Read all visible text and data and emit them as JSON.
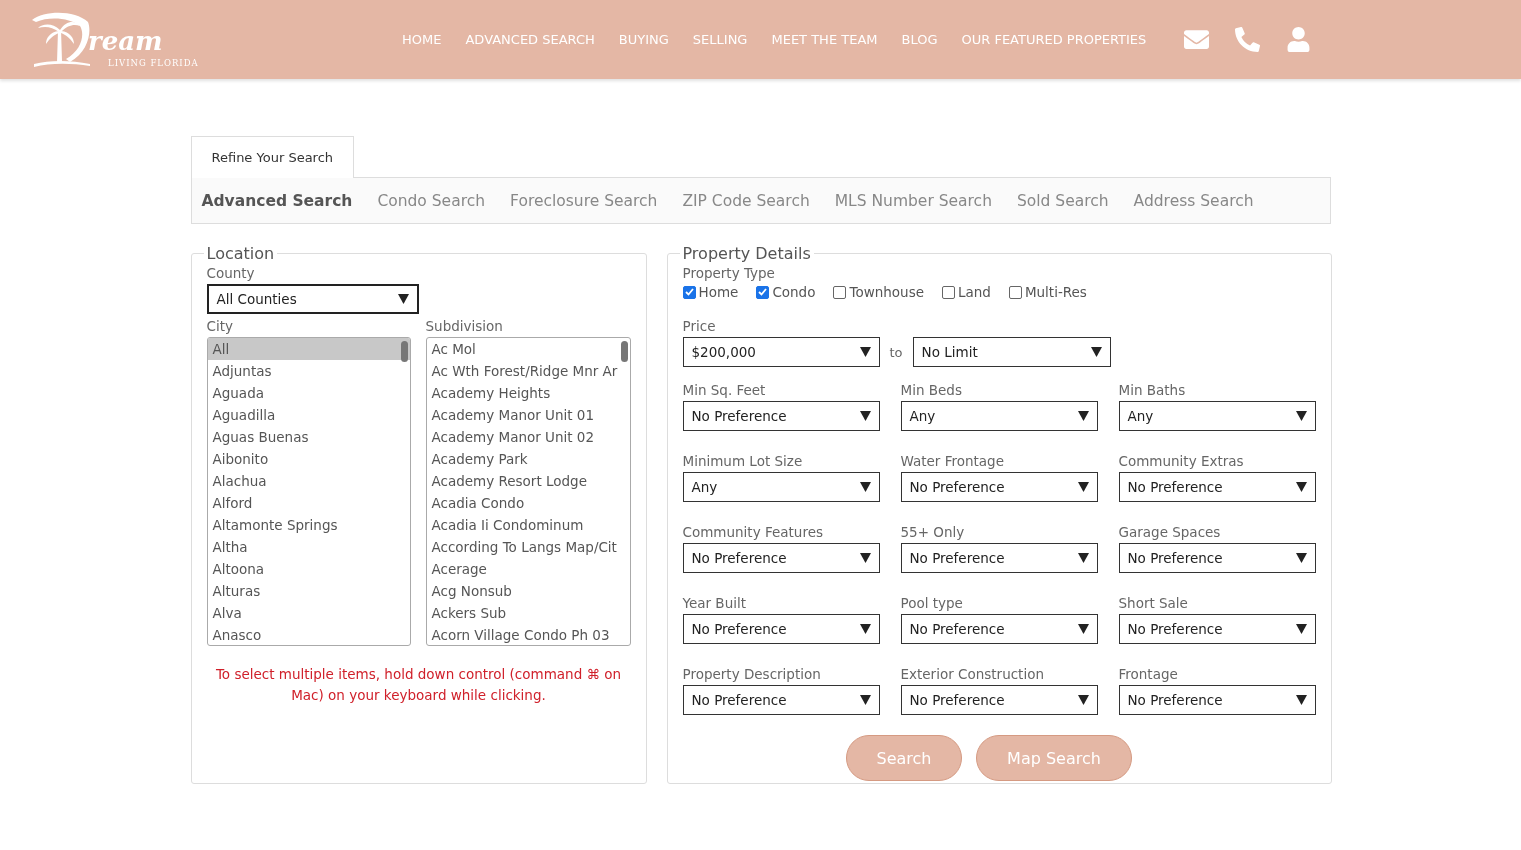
{
  "header": {
    "logo": {
      "title": "ream",
      "tagline": "LIVING FLORIDA"
    },
    "nav": [
      "HOME",
      "ADVANCED SEARCH",
      "BUYING",
      "SELLING",
      "MEET THE TEAM",
      "BLOG",
      "OUR FEATURED PROPERTIES"
    ]
  },
  "refine_tab": {
    "label": "Refine Your Search",
    "selected": true
  },
  "search_tabs": [
    {
      "label": "Advanced Search",
      "selected": true
    },
    {
      "label": "Condo Search",
      "selected": false
    },
    {
      "label": "Foreclosure Search",
      "selected": false
    },
    {
      "label": "ZIP Code Search",
      "selected": false
    },
    {
      "label": "MLS Number Search",
      "selected": false
    },
    {
      "label": "Sold Search",
      "selected": false
    },
    {
      "label": "Address Search",
      "selected": false
    }
  ],
  "location": {
    "legend": "Location",
    "county": {
      "label": "County",
      "value": "All Counties"
    },
    "city": {
      "label": "City",
      "items": [
        {
          "label": "All",
          "selected": true
        },
        {
          "label": "Adjuntas",
          "selected": false
        },
        {
          "label": "Aguada",
          "selected": false
        },
        {
          "label": "Aguadilla",
          "selected": false
        },
        {
          "label": "Aguas Buenas",
          "selected": false
        },
        {
          "label": "Aibonito",
          "selected": false
        },
        {
          "label": "Alachua",
          "selected": false
        },
        {
          "label": "Alford",
          "selected": false
        },
        {
          "label": "Altamonte Springs",
          "selected": false
        },
        {
          "label": "Altha",
          "selected": false
        },
        {
          "label": "Altoona",
          "selected": false
        },
        {
          "label": "Alturas",
          "selected": false
        },
        {
          "label": "Alva",
          "selected": false
        },
        {
          "label": "Anasco",
          "selected": false
        }
      ]
    },
    "subdivision": {
      "label": "Subdivision",
      "items": [
        {
          "label": "Ac Mol",
          "selected": false
        },
        {
          "label": "Ac Wth Forest/Ridge Mnr Ar",
          "selected": false
        },
        {
          "label": "Academy Heights",
          "selected": false
        },
        {
          "label": "Academy Manor Unit 01",
          "selected": false
        },
        {
          "label": "Academy Manor Unit 02",
          "selected": false
        },
        {
          "label": "Academy Park",
          "selected": false
        },
        {
          "label": "Academy Resort Lodge",
          "selected": false
        },
        {
          "label": "Acadia Condo",
          "selected": false
        },
        {
          "label": "Acadia Ii Condominum",
          "selected": false
        },
        {
          "label": "According To Langs Map/Cit",
          "selected": false
        },
        {
          "label": "Acerage",
          "selected": false
        },
        {
          "label": "Acg Nonsub",
          "selected": false
        },
        {
          "label": "Ackers Sub",
          "selected": false
        },
        {
          "label": "Acorn Village Condo Ph 03",
          "selected": false
        }
      ]
    },
    "hint": "To select multiple items, hold down control (command ⌘ on Mac) on your keyboard while clicking."
  },
  "property": {
    "legend": "Property Details",
    "property_type": {
      "label": "Property Type",
      "options": [
        {
          "label": "Home",
          "checked": true
        },
        {
          "label": "Condo",
          "checked": true
        },
        {
          "label": "Townhouse",
          "checked": false
        },
        {
          "label": "Land",
          "checked": false
        },
        {
          "label": "Multi-Res",
          "checked": false
        }
      ]
    },
    "price": {
      "label": "Price",
      "min": "$200,000",
      "separator": "to",
      "max": "No Limit"
    },
    "fields": [
      {
        "label": "Min Sq. Feet",
        "value": "No Preference"
      },
      {
        "label": "Min Beds",
        "value": "Any"
      },
      {
        "label": "Min Baths",
        "value": "Any"
      },
      {
        "label": "Minimum Lot Size",
        "value": "Any"
      },
      {
        "label": "Water Frontage",
        "value": "No Preference"
      },
      {
        "label": "Community Extras",
        "value": "No Preference"
      },
      {
        "label": "Community Features",
        "value": "No Preference"
      },
      {
        "label": "55+ Only",
        "value": "No Preference"
      },
      {
        "label": "Garage Spaces",
        "value": "No Preference"
      },
      {
        "label": "Year Built",
        "value": "No Preference"
      },
      {
        "label": "Pool type",
        "value": "No Preference"
      },
      {
        "label": "Short Sale",
        "value": "No Preference"
      },
      {
        "label": "Property Description",
        "value": "No Preference"
      },
      {
        "label": "Exterior Construction",
        "value": "No Preference"
      },
      {
        "label": "Frontage",
        "value": "No Preference"
      }
    ],
    "buttons": [
      "Search",
      "Map Search"
    ]
  }
}
